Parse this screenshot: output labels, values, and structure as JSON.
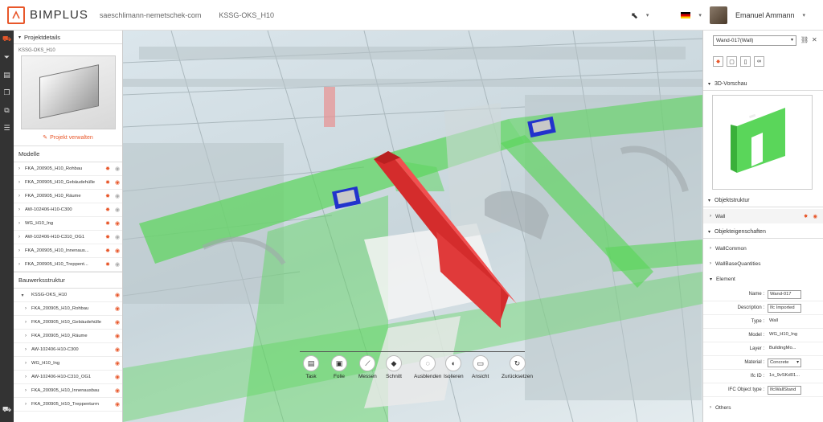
{
  "header": {
    "logo": "BIMPLUS",
    "email": "saeschlimann-nemetschek-com",
    "project": "KSSG-OKS_H10",
    "user": "Emanuel Ammann"
  },
  "rail": [
    "cart-icon",
    "filter-icon",
    "clipboard-icon",
    "layers-icon",
    "copy-icon",
    "stack-icon"
  ],
  "left": {
    "project_details": "Projektdetails",
    "project_name": "KSSG-OKS_H10",
    "manage": "Projekt verwalten",
    "models_title": "Modelle",
    "models": [
      {
        "name": "FKA_200905_H10_Rohbau",
        "eye": "grey"
      },
      {
        "name": "FKA_200905_H10_Gebäudehülle",
        "eye": "orange"
      },
      {
        "name": "FKA_200905_H10_Räume",
        "eye": "grey"
      },
      {
        "name": "AW-102406-H10-C300",
        "eye": "grey"
      },
      {
        "name": "WG_H10_Ing",
        "eye": "orange"
      },
      {
        "name": "AW-102406-H10-C310_OG1",
        "eye": "grey"
      },
      {
        "name": "FKA_200905_H10_Innenaus...",
        "eye": "orange"
      },
      {
        "name": "FKA_200905_H10_Treppent...",
        "eye": "grey"
      }
    ],
    "structure_title": "Bauwerksstruktur",
    "structure_root": "KSSG-OKS_H10",
    "structure": [
      "FKA_200905_H10_Rohbau",
      "FKA_200905_H10_Gebäudehülle",
      "FKA_200905_H10_Räume",
      "AW-102406-H10-C300",
      "WG_H10_Ing",
      "AW-102406-H10-C310_OG1",
      "FKA_200905_H10_Innenausbau",
      "FKA_200905_H10_Treppenturm"
    ]
  },
  "toolbar": [
    {
      "label": "Task",
      "icon": "clipboard-icon",
      "glyph": "▤"
    },
    {
      "label": "Folie",
      "icon": "slide-icon",
      "glyph": "▣"
    },
    {
      "label": "Messen",
      "icon": "ruler-icon",
      "glyph": "⟋"
    },
    {
      "label": "Schnitt",
      "icon": "section-cube-icon",
      "glyph": "◆"
    },
    {
      "label": "Ausblenden",
      "icon": "hide-icon",
      "glyph": "◌"
    },
    {
      "label": "Isolieren",
      "icon": "isolate-icon",
      "glyph": "◐"
    },
    {
      "label": "Ansicht",
      "icon": "camera-icon",
      "glyph": "▭"
    },
    {
      "label": "Zurücksetzen",
      "icon": "reset-icon",
      "glyph": "↻"
    }
  ],
  "right": {
    "selected": "Wand-017(Wall)",
    "preview_title": "3D-Vorschau",
    "structure_title": "Objektstruktur",
    "structure_item": "Wall",
    "props_title": "Objekteigenschaften",
    "groups": [
      "WallCommon",
      "WallBaseQuantities",
      "Element"
    ],
    "fields": [
      {
        "k": "Name :",
        "v": "Wand-017",
        "type": "input"
      },
      {
        "k": "Description :",
        "v": "Ifc Imported",
        "type": "input"
      },
      {
        "k": "Type :",
        "v": "Wall",
        "type": "plain"
      },
      {
        "k": "Model :",
        "v": "WG_H10_Ing",
        "type": "plain"
      },
      {
        "k": "Layer :",
        "v": "BuildingMo...",
        "type": "plain"
      },
      {
        "k": "Material :",
        "v": "Concrete",
        "type": "select"
      },
      {
        "k": "Ifc ID :",
        "v": "1o_9vSKd01...",
        "type": "plain"
      },
      {
        "k": "IFC Object type :",
        "v": "IfcWallStand",
        "type": "input"
      }
    ],
    "others": "Others"
  },
  "colors": {
    "accent": "#e8572a",
    "wall_green": "#5ad65a",
    "wall_red": "#e03a3a"
  }
}
